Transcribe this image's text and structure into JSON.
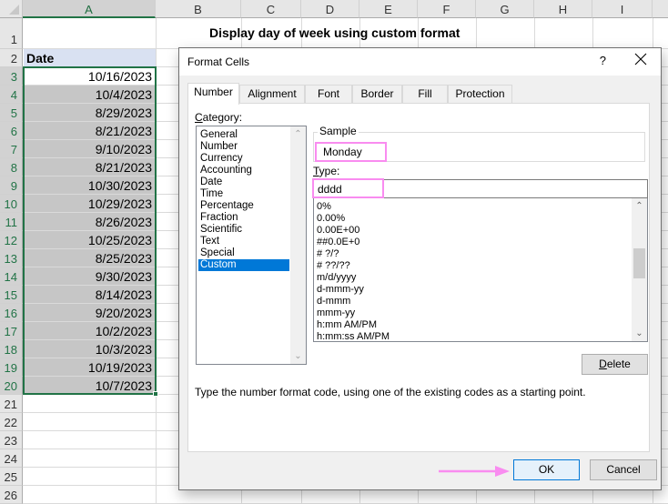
{
  "spreadsheet": {
    "columns": [
      "A",
      "B",
      "C",
      "D",
      "E",
      "F",
      "G",
      "H",
      "I"
    ],
    "active_column": "A",
    "rows": [
      "1",
      "2",
      "3",
      "4",
      "5",
      "6",
      "7",
      "8",
      "9",
      "10",
      "11",
      "12",
      "13",
      "14",
      "15",
      "16",
      "17",
      "18",
      "19",
      "20",
      "21",
      "22",
      "23",
      "24",
      "25",
      "26"
    ],
    "active_rows_from": 3,
    "active_rows_to": 20,
    "title": "Display day of week using custom format",
    "header_cell": "Date",
    "dates": [
      "10/16/2023",
      "10/4/2023",
      "8/29/2023",
      "8/21/2023",
      "9/10/2023",
      "8/21/2023",
      "10/30/2023",
      "10/29/2023",
      "8/26/2023",
      "10/25/2023",
      "8/25/2023",
      "9/30/2023",
      "8/14/2023",
      "9/20/2023",
      "10/2/2023",
      "10/3/2023",
      "10/19/2023",
      "10/7/2023"
    ],
    "colors": {
      "selection_border": "#217346",
      "header_fill": "#d9e1f2",
      "selected_fill": "#c6c6c6"
    }
  },
  "dialog": {
    "title": "Format Cells",
    "help_label": "?",
    "close_icon": "close-icon",
    "tabs": [
      "Number",
      "Alignment",
      "Font",
      "Border",
      "Fill",
      "Protection"
    ],
    "active_tab": "Number",
    "category_label": "Category:",
    "categories": [
      "General",
      "Number",
      "Currency",
      "Accounting",
      "Date",
      "Time",
      "Percentage",
      "Fraction",
      "Scientific",
      "Text",
      "Special",
      "Custom"
    ],
    "selected_category": "Custom",
    "sample_label": "Sample",
    "sample_value": "Monday",
    "type_label": "Type:",
    "type_value": "dddd",
    "format_codes": [
      "0%",
      "0.00%",
      "0.00E+00",
      "##0.0E+0",
      "# ?/?",
      "# ??/??",
      "m/d/yyyy",
      "d-mmm-yy",
      "d-mmm",
      "mmm-yy",
      "h:mm AM/PM",
      "h:mm:ss AM/PM"
    ],
    "delete_label": "Delete",
    "hint": "Type the number format code, using one of the existing codes as a starting point.",
    "ok_label": "OK",
    "cancel_label": "Cancel",
    "colors": {
      "highlight": "#f98cf0",
      "selection": "#0078d7"
    }
  }
}
